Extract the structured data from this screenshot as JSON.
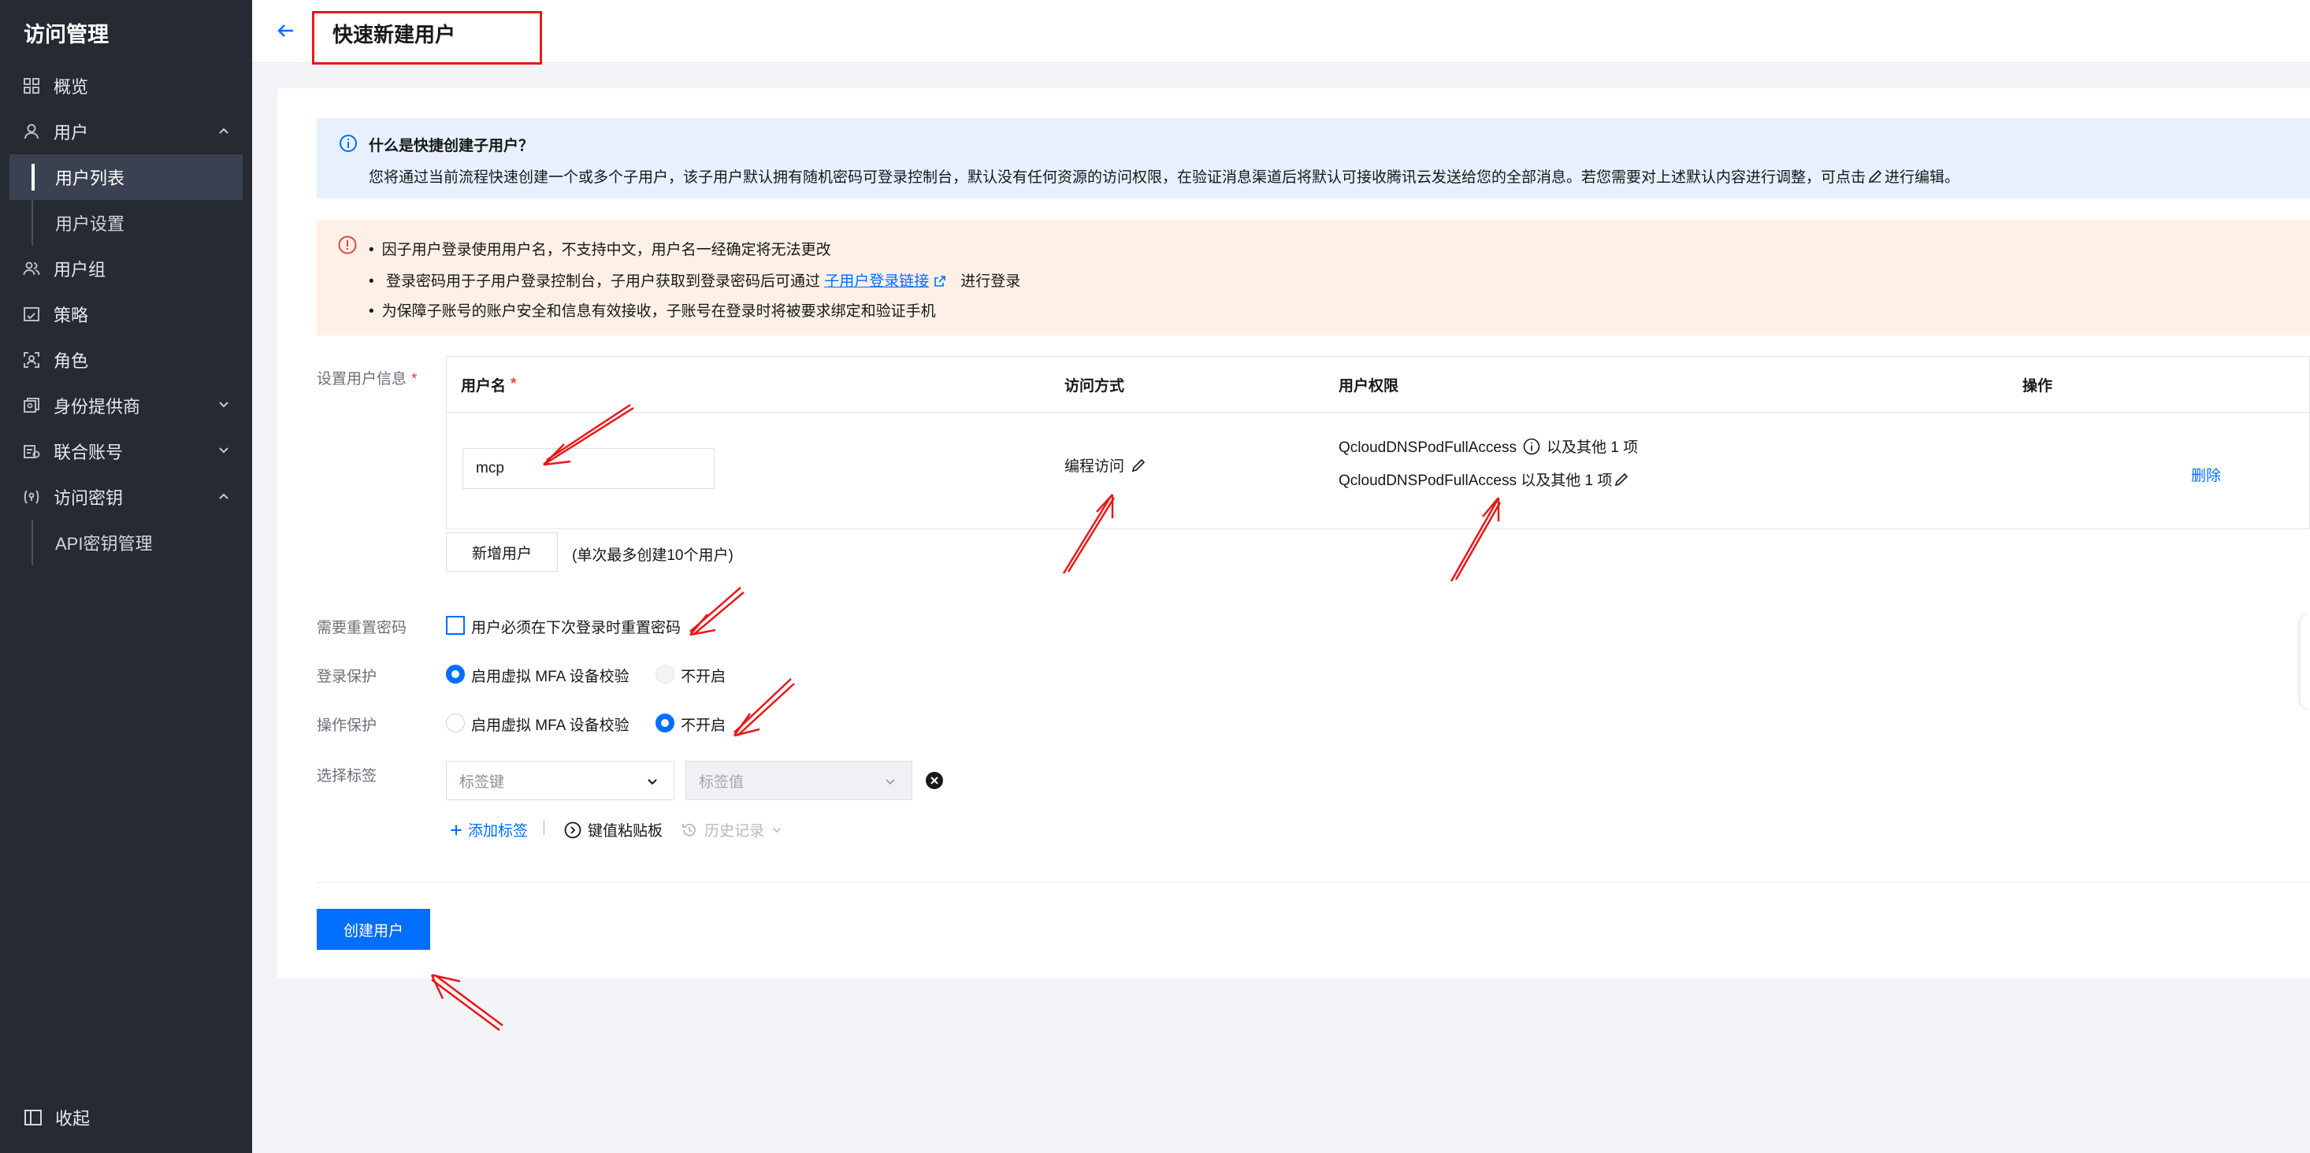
{
  "sidebar": {
    "title": "访问管理",
    "items": [
      {
        "label": "概览",
        "icon": "grid-icon"
      },
      {
        "label": "用户",
        "icon": "user-icon",
        "chevron": "up"
      },
      {
        "label": "用户列表",
        "sub": true,
        "active": true
      },
      {
        "label": "用户设置",
        "sub": true
      },
      {
        "label": "用户组",
        "icon": "user-group-icon"
      },
      {
        "label": "策略",
        "icon": "policy-icon"
      },
      {
        "label": "角色",
        "icon": "role-icon"
      },
      {
        "label": "身份提供商",
        "icon": "identity-provider-icon",
        "chevron": "down"
      },
      {
        "label": "联合账号",
        "icon": "federated-account-icon",
        "chevron": "down"
      },
      {
        "label": "访问密钥",
        "icon": "access-key-icon",
        "chevron": "up"
      },
      {
        "label": "API密钥管理",
        "sub": true
      }
    ],
    "collapse_label": "收起"
  },
  "header": {
    "title": "快速新建用户"
  },
  "info": {
    "title": "什么是快捷创建子用户？",
    "text_before": "您将通过当前流程快速创建一个或多个子用户，该子用户默认拥有随机密码可登录控制台，默认没有任何资源的访问权限，在验证消息渠道后将默认可接收腾讯云发送给您的全部消息。若您需要对上述默认内容进行调整，可点击",
    "text_after": "进行编辑。"
  },
  "warning": {
    "line1": "因子用户登录使用用户名，不支持中文，用户名一经确定将无法更改",
    "line2_before": "登录密码用于子用户登录控制台，子用户获取到登录密码后可通过",
    "line2_link": "子用户登录链接",
    "line2_after": "进行登录",
    "line3": "为保障子账号的账户安全和信息有效接收，子账号在登录时将被要求绑定和验证手机"
  },
  "form": {
    "user_info_label": "设置用户信息",
    "required_mark": "*",
    "table": {
      "columns": [
        "用户名",
        "访问方式",
        "用户权限",
        "操作"
      ],
      "username_required_mark": "*",
      "rows": [
        {
          "username": "mcp",
          "access": "编程访问",
          "permission_line1_policy": "QcloudDNSPodFullAccess",
          "permission_line1_more": "以及其他 1 项",
          "permission_line2": "QcloudDNSPodFullAccess 以及其他 1 项",
          "action": "删除"
        }
      ]
    },
    "add_user_button": "新增用户",
    "add_user_hint": "(单次最多创建10个用户)",
    "reset_password_label": "需要重置密码",
    "reset_password_option": "用户必须在下次登录时重置密码",
    "reset_password_checked": false,
    "login_protection_label": "登录保护",
    "login_protection_options": [
      "启用虚拟 MFA 设备校验",
      "不开启"
    ],
    "login_protection_selected": "启用虚拟 MFA 设备校验",
    "operation_protection_label": "操作保护",
    "operation_protection_options": [
      "启用虚拟 MFA 设备校验",
      "不开启"
    ],
    "operation_protection_selected": "不开启",
    "tag_label": "选择标签",
    "tag_key_placeholder": "标签键",
    "tag_value_placeholder": "标签值",
    "add_tag": "添加标签",
    "separator": "|",
    "paste_board": "键值粘贴板",
    "history": "历史记录"
  },
  "submit_button": "创建用户",
  "colors": {
    "sidebar_bg": "#262a32",
    "primary": "#006eff",
    "info_bg": "#e8f0fe",
    "warning_bg": "#fdf0e6",
    "annotation": "#ea1717"
  }
}
